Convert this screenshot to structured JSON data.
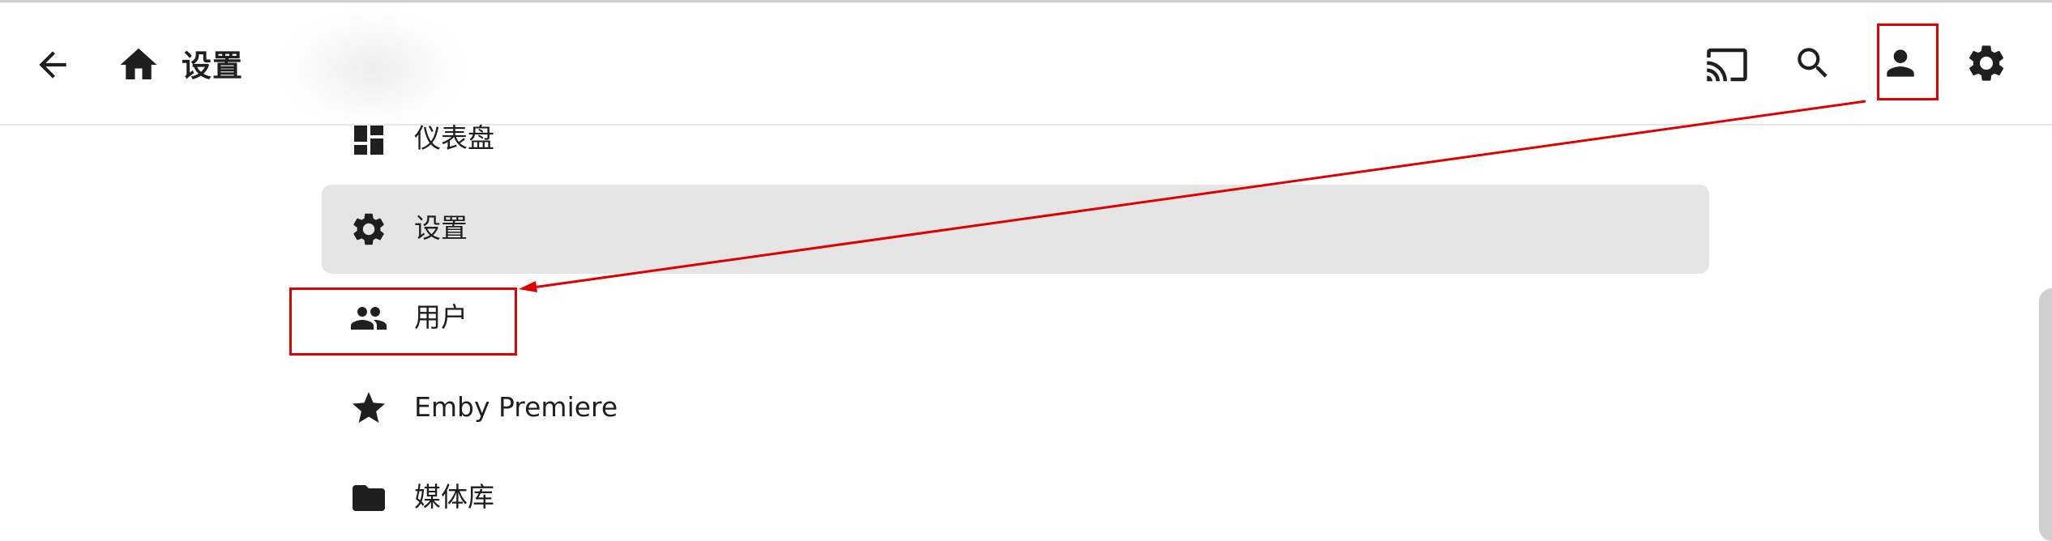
{
  "header": {
    "title": "设置",
    "back_icon": "arrow-left-icon",
    "home_icon": "home-icon",
    "actions": [
      {
        "name": "cast-button",
        "icon": "cast-icon"
      },
      {
        "name": "search-button",
        "icon": "search-icon"
      },
      {
        "name": "user-button",
        "icon": "person-icon"
      },
      {
        "name": "settings-button",
        "icon": "gear-icon"
      }
    ]
  },
  "menu": {
    "items": [
      {
        "label": "仪表盘",
        "icon": "dashboard-icon"
      },
      {
        "label": "设置",
        "icon": "gear-icon",
        "active": true
      },
      {
        "label": "用户",
        "icon": "people-icon"
      },
      {
        "label": "Emby Premiere",
        "icon": "star-icon"
      },
      {
        "label": "媒体库",
        "icon": "folder-icon"
      }
    ]
  },
  "colors": {
    "annotation": "#e00000",
    "active_background": "#e5e5e5",
    "icon": "#1f1f1f"
  }
}
